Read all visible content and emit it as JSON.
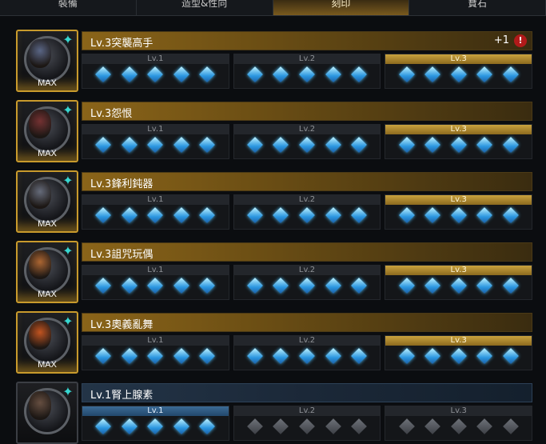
{
  "tabs": [
    {
      "label": "裝備",
      "active": false
    },
    {
      "label": "造型&性向",
      "active": false
    },
    {
      "label": "刻印",
      "active": true
    },
    {
      "label": "寶石",
      "active": false
    }
  ],
  "level_labels": [
    "Lv.1",
    "Lv.2",
    "Lv.3"
  ],
  "max_label": "MAX",
  "engravings": [
    {
      "title": "Lv.3突襲高手",
      "level": 3,
      "max": true,
      "plus": "+1",
      "alert": "!",
      "face_color": "#5d6a8c"
    },
    {
      "title": "Lv.3怨恨",
      "level": 3,
      "max": true,
      "face_color": "#7a3030"
    },
    {
      "title": "Lv.3鋒利鈍器",
      "level": 3,
      "max": true,
      "face_color": "#6a7080"
    },
    {
      "title": "Lv.3詛咒玩偶",
      "level": 3,
      "max": true,
      "face_color": "#b86a30"
    },
    {
      "title": "Lv.3奧義亂舞",
      "level": 3,
      "max": true,
      "face_color": "#d0561c"
    },
    {
      "title": "Lv.1腎上腺素",
      "level": 1,
      "max": false,
      "face_color": "#6a5040"
    }
  ]
}
